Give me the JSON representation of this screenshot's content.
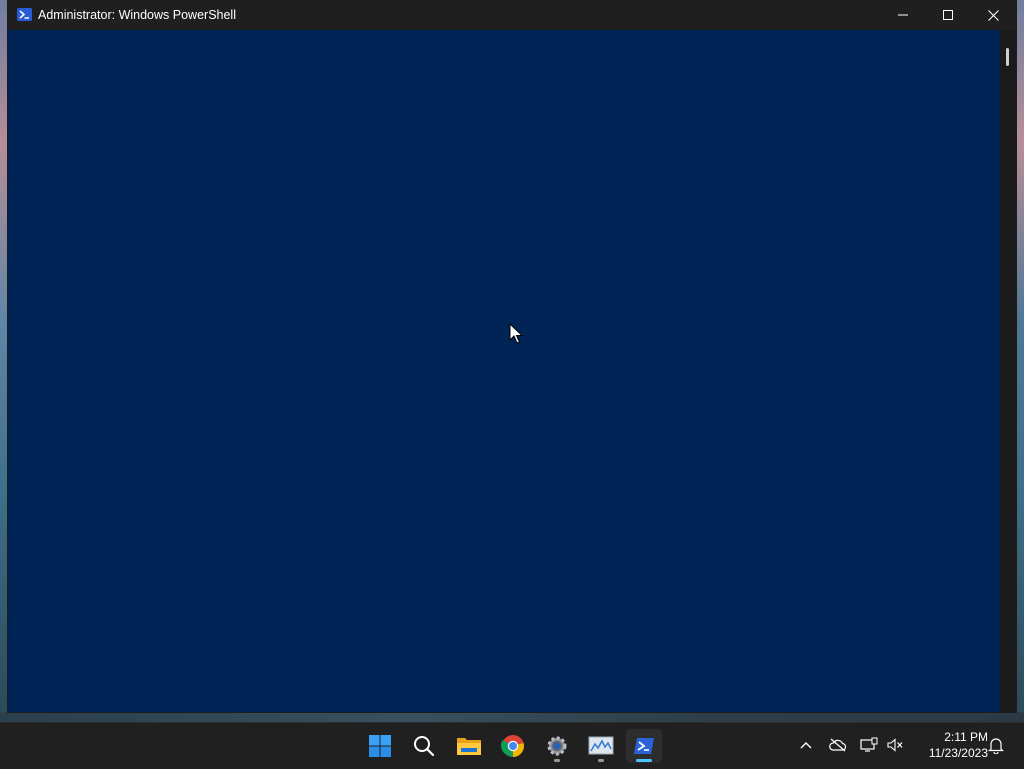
{
  "window": {
    "title": "Administrator: Windows PowerShell"
  },
  "taskbar": {
    "apps": [
      {
        "name": "Start"
      },
      {
        "name": "Search"
      },
      {
        "name": "File Explorer"
      },
      {
        "name": "Google Chrome"
      },
      {
        "name": "Settings"
      },
      {
        "name": "Resource Monitor"
      },
      {
        "name": "Windows PowerShell"
      }
    ]
  },
  "tray": {
    "time": "2:11 PM",
    "date": "11/23/2023"
  },
  "colors": {
    "console_bg": "#012456",
    "titlebar_bg": "#1f1f1f",
    "taskbar_bg": "#202020",
    "accent": "#4cc2ff"
  }
}
